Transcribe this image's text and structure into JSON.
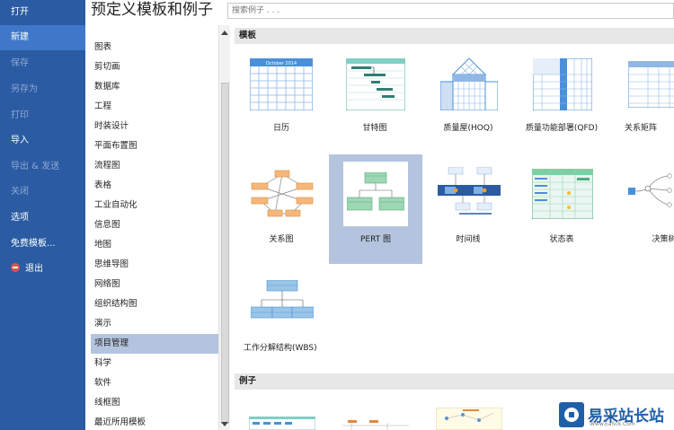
{
  "nav": {
    "items": [
      {
        "label": "打开"
      },
      {
        "label": "新建"
      },
      {
        "label": "保存"
      },
      {
        "label": "另存为"
      },
      {
        "label": "打印"
      },
      {
        "label": "导入"
      },
      {
        "label": "导出 & 发送"
      },
      {
        "label": "关闭"
      },
      {
        "label": "选项"
      },
      {
        "label": "免费模板..."
      },
      {
        "label": "退出"
      }
    ]
  },
  "header": {
    "title": "预定义模板和例子",
    "search_placeholder": "搜索例子 . . ."
  },
  "categories": [
    {
      "label": "图表"
    },
    {
      "label": "剪切画"
    },
    {
      "label": "数据库"
    },
    {
      "label": "工程"
    },
    {
      "label": "时装设计"
    },
    {
      "label": "平面布置图"
    },
    {
      "label": "流程图"
    },
    {
      "label": "表格"
    },
    {
      "label": "工业自动化"
    },
    {
      "label": "信息图"
    },
    {
      "label": "地图"
    },
    {
      "label": "思维导图"
    },
    {
      "label": "网络图"
    },
    {
      "label": "组织结构图"
    },
    {
      "label": "演示"
    },
    {
      "label": "项目管理"
    },
    {
      "label": "科学"
    },
    {
      "label": "软件"
    },
    {
      "label": "线框图"
    },
    {
      "label": "最近所用模板"
    }
  ],
  "gallery": {
    "templates_header": "模板",
    "examples_header": "例子",
    "templates": [
      {
        "label": "日历",
        "thumb_caption": "October 2014"
      },
      {
        "label": "甘特图"
      },
      {
        "label": "质量屋(HOQ)"
      },
      {
        "label": "质量功能部署(QFD)"
      },
      {
        "label": "关系矩阵"
      },
      {
        "label": "关系图"
      },
      {
        "label": "PERT 图"
      },
      {
        "label": "时间线"
      },
      {
        "label": "状态表"
      },
      {
        "label": "决策树"
      },
      {
        "label": "工作分解结构(WBS)"
      }
    ]
  },
  "watermark": {
    "text": "易采站长站",
    "url": "Www.EaSck.Com"
  },
  "colors": {
    "nav_bg": "#2a5ba3",
    "nav_active": "#3f78c9",
    "selection": "#b4c4de",
    "accent_blue": "#4a90d9"
  }
}
